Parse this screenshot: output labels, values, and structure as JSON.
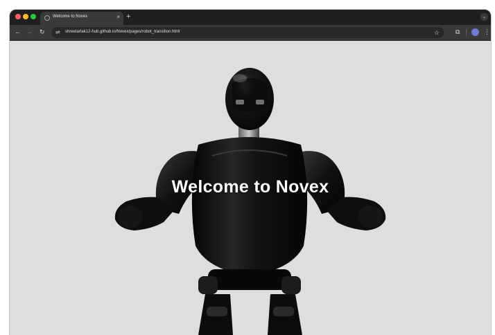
{
  "browser": {
    "tab": {
      "title": "Welcome to Novex",
      "close_glyph": "×"
    },
    "new_tab_glyph": "+",
    "tab_menu_glyph": "⌄",
    "nav": {
      "back_glyph": "←",
      "forward_glyph": "→",
      "reload_glyph": "↻"
    },
    "address_bar": {
      "site_info_glyph": "⇌",
      "url": "shreetarlak12-hub.github.io/Novex/pages/robot_transition.html",
      "bookmark_glyph": "☆"
    },
    "toolbar_icons": {
      "extensions_glyph": "⧉",
      "menu_glyph": "⋮"
    }
  },
  "page": {
    "heading": "Welcome to Novex",
    "background_color": "#dedede",
    "robot_color": "#0d0d0d"
  },
  "colors": {
    "traffic_red": "#ff5f57",
    "traffic_yellow": "#febc2e",
    "traffic_green": "#28c840",
    "tabbar": "#1f1f1f",
    "toolbar": "#3a3a3a"
  }
}
